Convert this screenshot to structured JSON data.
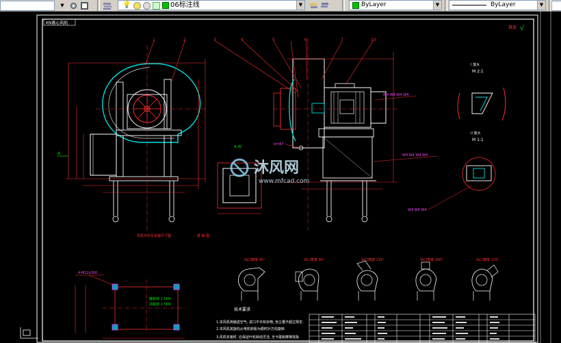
{
  "toolbar": {
    "layer_name": "06标注线",
    "color_value": "ByLayer",
    "linetype_value": "ByLayer",
    "colors": {
      "layer_swatch": "#00c000",
      "color_swatch": "#00c000"
    }
  },
  "drawing": {
    "frame_title": "KN离心风机",
    "corner_mark": "其余",
    "view_a_label": "A 向",
    "view_a_arrow": "A",
    "detail_i_label": "I 放大",
    "detail_i_scale": "M 2:1",
    "detail_ii_label": "II 放大",
    "detail_ii_scale": "M 1:1",
    "weld_callout": "W4 W4 W4 W4",
    "weld_callout_2": "W4 W4 W4 W4",
    "weld_callout_3": "W4 W4 W4",
    "left_callout": "b=Φ7",
    "left_subtitle": "风机外形及安装尺寸图",
    "mid_subtitle": "基 础 图",
    "foundation_bolts": "4-M12x300",
    "load_label_1": "静载荷 1.5KN",
    "load_label_2": "动载荷 2.5KN",
    "part_numbers": [
      "1",
      "2",
      "3",
      "4",
      "5",
      "6",
      "7",
      "8",
      "9",
      "10"
    ],
    "rotation_views": [
      "出口角度 45°",
      "出口角度 90°",
      "出口角度 135°",
      "出口角度 180°",
      "出口角度 225°"
    ],
    "notes_title": "技术要求",
    "notes": [
      "1.本风机用输送空气, 进口不许有杂物, 含尘量不超过规定.",
      "2.本风机其旋向从电机侧看为顺时针方向旋转.",
      "3.风机安装时, 应保证叶轮转动灵活, 无卡碰和摩擦现象."
    ],
    "watermark_main": "沐风网",
    "watermark_url": "www.mfcad.com"
  }
}
